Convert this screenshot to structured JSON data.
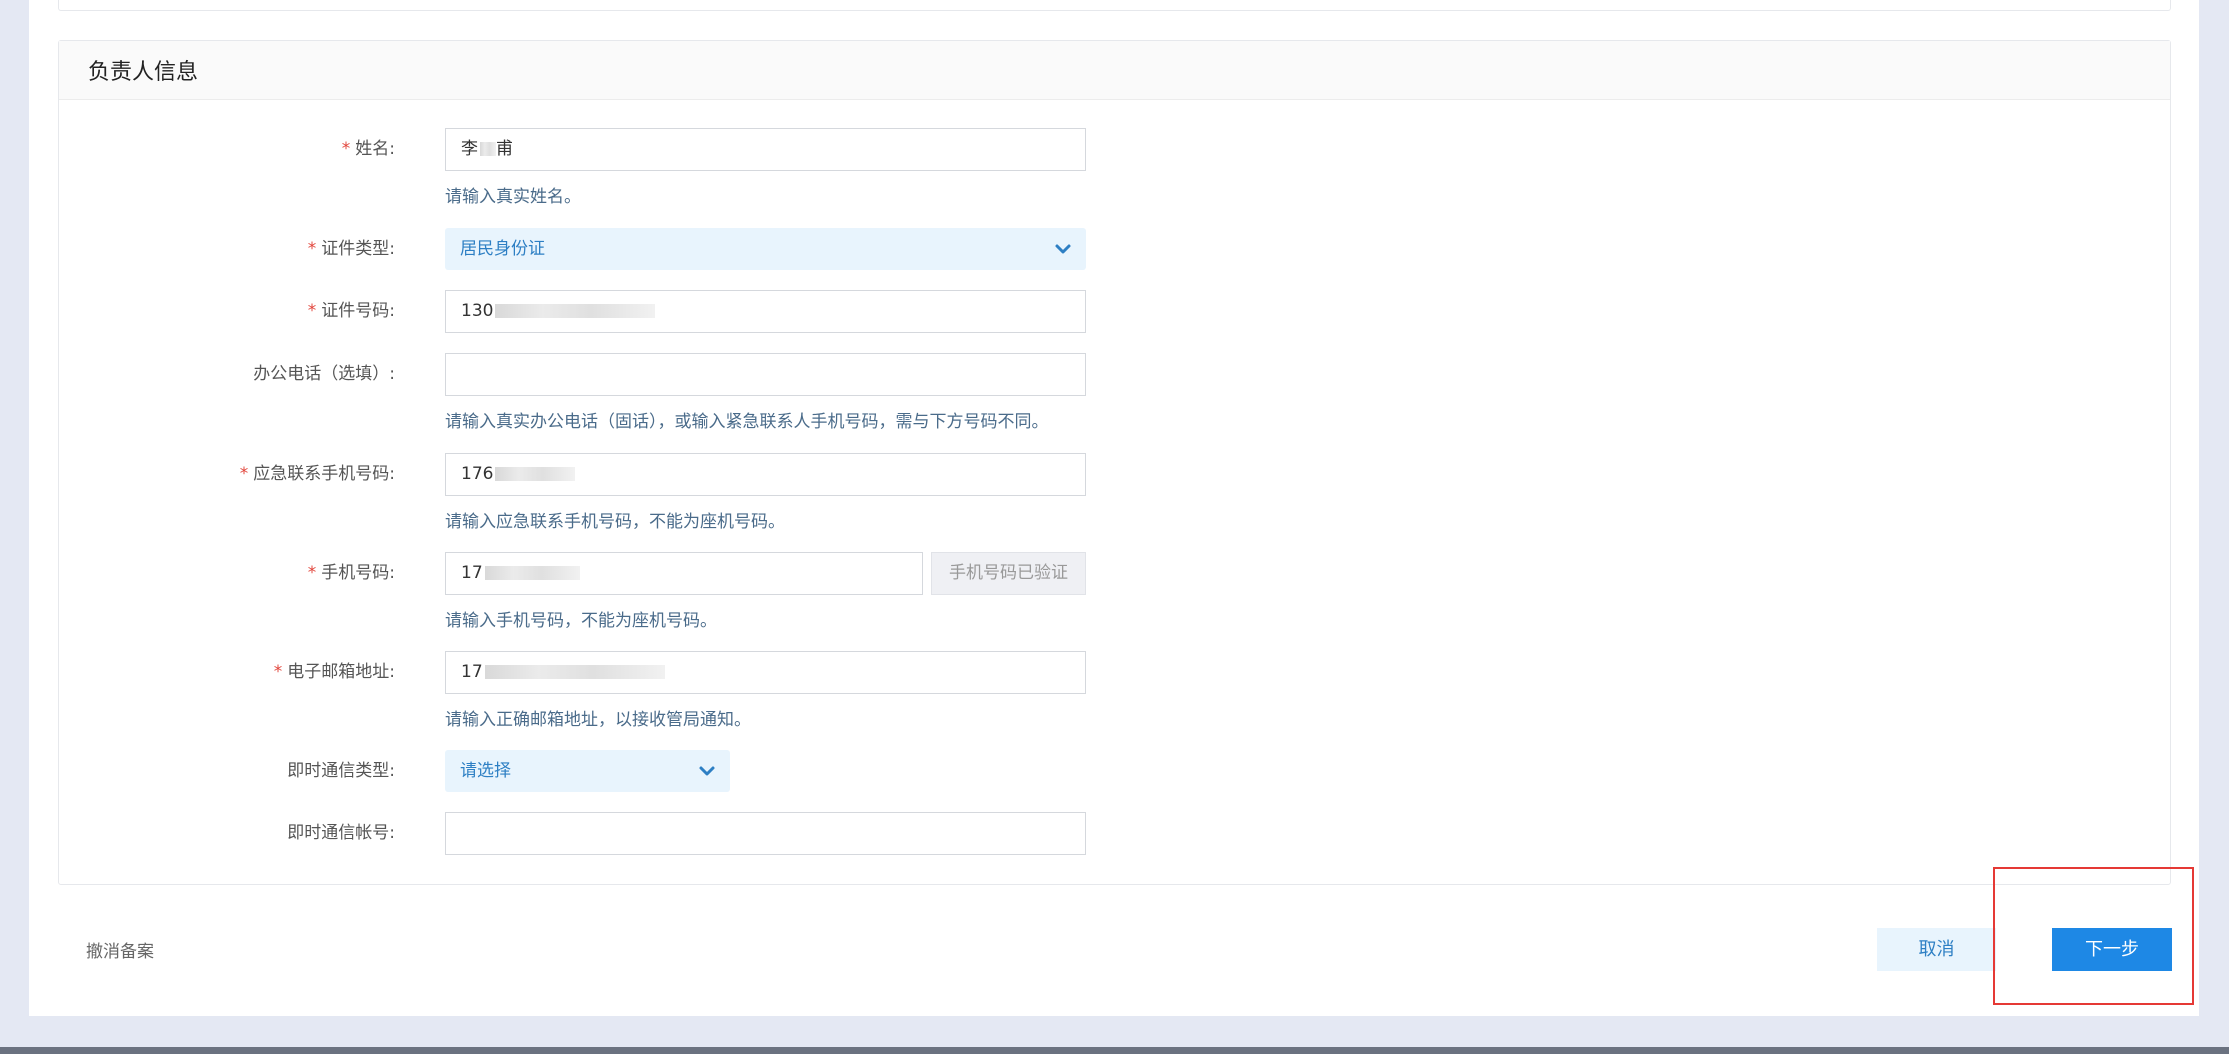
{
  "section": {
    "title": "负责人信息"
  },
  "form": {
    "name": {
      "label": "姓名:",
      "required": true,
      "value_visible": "李",
      "value_tail": "甫",
      "hint": "请输入真实姓名。"
    },
    "id_type": {
      "label": "证件类型:",
      "required": true,
      "selected": "居民身份证"
    },
    "id_number": {
      "label": "证件号码:",
      "required": true,
      "value_visible": "130"
    },
    "office_phone": {
      "label": "办公电话（选填）:",
      "required": false,
      "value_visible": "",
      "hint": "请输入真实办公电话（固话），或输入紧急联系人手机号码，需与下方号码不同。"
    },
    "emergency_phone": {
      "label": "应急联系手机号码:",
      "required": true,
      "value_visible": "176",
      "hint": "请输入应急联系手机号码，不能为座机号码。"
    },
    "mobile": {
      "label": "手机号码:",
      "required": true,
      "value_visible": "17",
      "verify_label": "手机号码已验证",
      "hint": "请输入手机号码，不能为座机号码。"
    },
    "email": {
      "label": "电子邮箱地址:",
      "required": true,
      "value_visible": "17",
      "hint": "请输入正确邮箱地址，以接收管局通知。"
    },
    "im_type": {
      "label": "即时通信类型:",
      "required": false,
      "selected": "请选择"
    },
    "im_account": {
      "label": "即时通信帐号:",
      "required": false,
      "value_visible": ""
    }
  },
  "footer": {
    "cancel_filing": "撤消备案",
    "cancel": "取消",
    "next": "下一步"
  },
  "required_mark": "*",
  "colors": {
    "primary": "#1e88e5",
    "select_bg": "#e8f4fd",
    "required": "#e2463c",
    "highlight": "#e53935"
  }
}
